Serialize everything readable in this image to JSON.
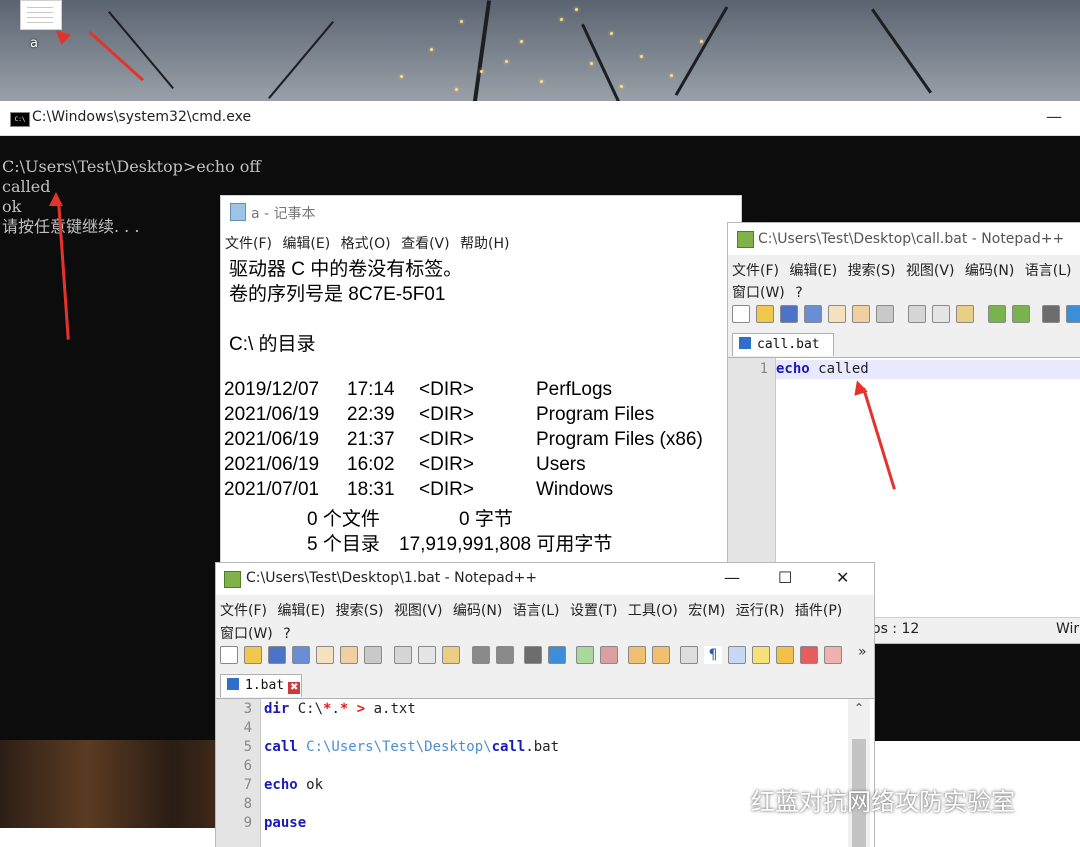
{
  "desktop": {
    "icon_label": "a"
  },
  "cmd": {
    "title": "C:\\Windows\\system32\\cmd.exe",
    "minimize": "—",
    "lines": [
      "C:\\Users\\Test\\Desktop>echo off",
      "called",
      "ok",
      "请按任意键继续. . ."
    ]
  },
  "notepad": {
    "title": "a - 记事本",
    "menu": [
      "文件(F)",
      "编辑(E)",
      "格式(O)",
      "查看(V)",
      "帮助(H)"
    ],
    "lines": [
      "驱动器 C 中的卷没有标签。",
      "卷的序列号是 8C7E-5F01",
      "C:\\ 的目录"
    ],
    "dir_entries": [
      {
        "date": "2019/12/07",
        "time": "17:14",
        "type": "<DIR>",
        "name": "PerfLogs"
      },
      {
        "date": "2021/06/19",
        "time": "22:39",
        "type": "<DIR>",
        "name": "Program Files"
      },
      {
        "date": "2021/06/19",
        "time": "21:37",
        "type": "<DIR>",
        "name": "Program Files (x86)"
      },
      {
        "date": "2021/06/19",
        "time": "16:02",
        "type": "<DIR>",
        "name": "Users"
      },
      {
        "date": "2021/07/01",
        "time": "18:31",
        "type": "<DIR>",
        "name": "Windows"
      }
    ],
    "summary": [
      {
        "count": "0 个文件",
        "value": "0 字节"
      },
      {
        "count": "5 个目录",
        "value": "17,919,991,808 可用字节"
      }
    ]
  },
  "npp_call": {
    "title": "C:\\Users\\Test\\Desktop\\call.bat - Notepad++",
    "menu": [
      "文件(F)",
      "编辑(E)",
      "搜索(S)",
      "视图(V)",
      "编码(N)",
      "语言(L)",
      "设"
    ],
    "menu2": [
      "窗口(W)",
      "?"
    ],
    "tab": "call.bat",
    "tab_close": "✖",
    "line_numbers": [
      "1"
    ],
    "code": {
      "keyword": "echo",
      "rest": " called"
    },
    "status_pos": "os : 12",
    "status_right": "Wir",
    "status_x": "X"
  },
  "npp_one": {
    "title": "C:\\Users\\Test\\Desktop\\1.bat - Notepad++",
    "min": "—",
    "max": "☐",
    "close": "✕",
    "menu": [
      "文件(F)",
      "编辑(E)",
      "搜索(S)",
      "视图(V)",
      "编码(N)",
      "语言(L)",
      "设置(T)",
      "工具(O)",
      "宏(M)",
      "运行(R)",
      "插件(P)"
    ],
    "menu2": [
      "窗口(W)",
      "?"
    ],
    "toolbar_more": "»",
    "tab": "1.bat",
    "tab_close": "✖",
    "line_numbers": [
      "3",
      "4",
      "5",
      "6",
      "7",
      "8",
      "9"
    ],
    "code": {
      "l3_kw": "dir",
      "l3_a": " C:\\",
      "l3_op1": "*",
      "l3_b": ".",
      "l3_op2": "*",
      "l3_c": " ",
      "l3_op3": ">",
      "l3_d": " a.txt",
      "l5_kw": "call",
      "l5_path": " C:\\Users\\Test\\Desktop\\",
      "l5_bold": "call",
      "l5_rest": ".bat",
      "l7_kw": "echo",
      "l7_rest": " ok",
      "l9_kw": "pause"
    },
    "scroll_up": "⌃"
  },
  "watermark": "红蓝对抗网络攻防实验室",
  "colors": {
    "arrow": "#e4332d",
    "keyword": "#1a1ab8",
    "path": "#4a8fd0",
    "highlight": "#e8e8ff"
  }
}
